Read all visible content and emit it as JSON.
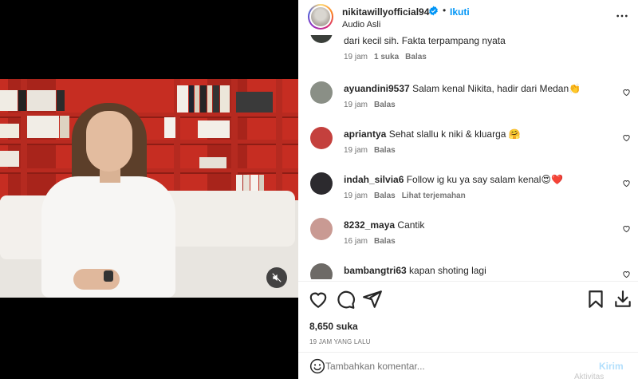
{
  "header": {
    "username": "nikitawillyofficial94",
    "dot": "•",
    "follow_label": "Ikuti",
    "audio_label": "Audio Asli",
    "verified_icon": "verified-badge-icon",
    "more_icon": "more-options-icon"
  },
  "comments": [
    {
      "username": "",
      "text": "dari kecil sih. Fakta terpampang nyata",
      "time": "19 jam",
      "likes": "1 suka",
      "reply": "Balas",
      "translate": "",
      "avatar_color": "#3a3f3a"
    },
    {
      "username": "ayuandini9537",
      "text": "Salam kenal Nikita, hadir dari Medan👏",
      "time": "19 jam",
      "likes": "",
      "reply": "Balas",
      "translate": "",
      "avatar_color": "#8a8f86"
    },
    {
      "username": "apriantya",
      "text": "Sehat slallu k niki & kluarga 🤗",
      "time": "19 jam",
      "likes": "",
      "reply": "Balas",
      "translate": "",
      "avatar_color": "#c4403d"
    },
    {
      "username": "indah_silvia6",
      "text": "Follow ig ku ya say salam kenal😍❤️",
      "time": "19 jam",
      "likes": "",
      "reply": "Balas",
      "translate": "Lihat terjemahan",
      "avatar_color": "#2c2a2e"
    },
    {
      "username": "8232_maya",
      "text": "Cantik",
      "time": "16 jam",
      "likes": "",
      "reply": "Balas",
      "translate": "",
      "avatar_color": "#c99a93"
    },
    {
      "username": "bambangtri63",
      "text": "kapan shoting lagi",
      "time": "",
      "likes": "",
      "reply": "",
      "translate": "",
      "avatar_color": "#6d6a66"
    }
  ],
  "footer": {
    "likes": "8,650 suka",
    "time_ago": "19 JAM YANG LALU",
    "comment_placeholder": "Tambahkan komentar...",
    "post_label": "Kirim",
    "faint_text": "Aktivitas"
  },
  "icons": {
    "like": "heart-icon",
    "comment": "comment-icon",
    "share": "share-icon",
    "save": "bookmark-icon",
    "download": "download-icon",
    "emoji": "emoji-icon",
    "mute": "muted-speaker-icon"
  },
  "colors": {
    "accent": "#0095f6",
    "text": "#262626",
    "muted": "#737373",
    "post_disabled": "#b2dffc"
  }
}
